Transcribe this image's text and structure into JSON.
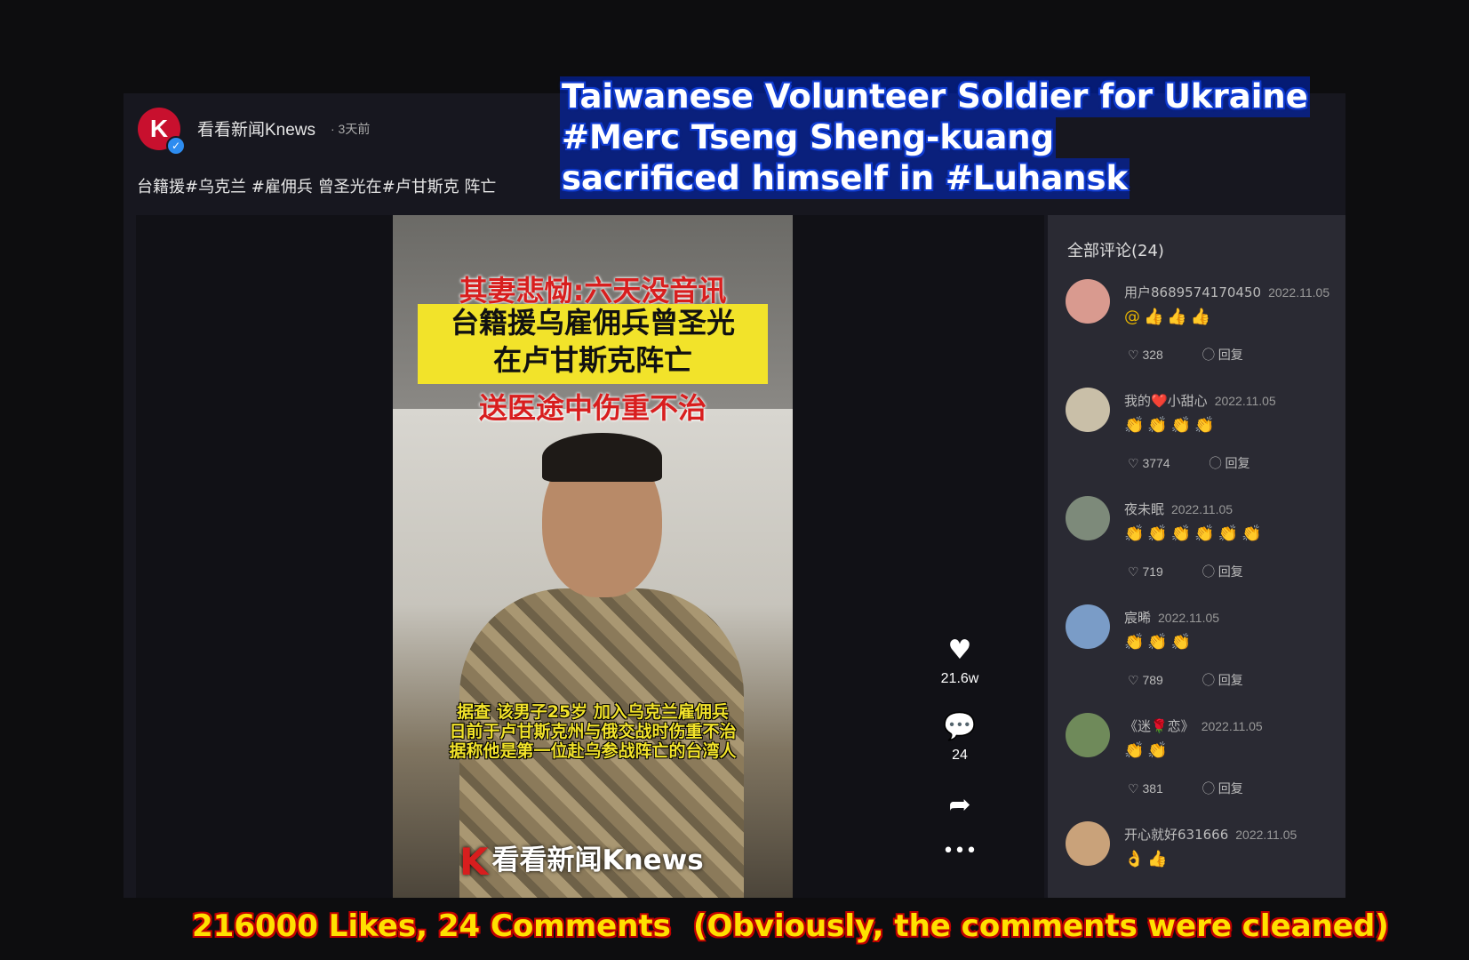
{
  "post": {
    "author": "看看新闻Knews",
    "time": "· 3天前",
    "caption": "台籍援#乌克兰 #雇佣兵 曾圣光在#卢甘斯克 阵亡",
    "logo_letter": "K"
  },
  "overlay": {
    "line1": "Taiwanese Volunteer Soldier for Ukraine",
    "line2": "#Merc  Tseng Sheng-kuang",
    "line3": "sacrificed himself in #Luhansk"
  },
  "video": {
    "banner_top": "其妻悲恸:六天没音讯",
    "headline_1": "台籍援乌雇佣兵曾圣光",
    "headline_2": "在卢甘斯克阵亡",
    "banner_bottom": "送医途中伤重不治",
    "subtitle_1": "据查 该男子25岁 加入乌克兰雇佣兵",
    "subtitle_2": "日前于卢甘斯克州与俄交战时伤重不治",
    "subtitle_3": "据称他是第一位赴乌参战阵亡的台湾人",
    "watermark": "看看新闻Knews"
  },
  "actions": {
    "likes": "21.6w",
    "comments": "24",
    "heart_icon": "heart-icon",
    "comment_icon": "comment-icon",
    "share_icon": "share-icon",
    "more_icon": "more-icon"
  },
  "comments_panel": {
    "title": "全部评论(24)",
    "reply_label": "回复",
    "items": [
      {
        "name": "用户8689574170450",
        "date": "2022.11.05",
        "text": "@👍👍👍",
        "likes": "328",
        "avatar_color": "#d99a8f"
      },
      {
        "name": "我的❤️小甜心",
        "date": "2022.11.05",
        "text": "👏👏👏👏",
        "likes": "3774",
        "avatar_color": "#c9bfa8"
      },
      {
        "name": "夜未眠",
        "date": "2022.11.05",
        "text": "👏👏👏👏👏👏",
        "likes": "719",
        "avatar_color": "#7d8a7a"
      },
      {
        "name": "宸晞",
        "date": "2022.11.05",
        "text": "👏👏👏",
        "likes": "789",
        "avatar_color": "#7a9cc7"
      },
      {
        "name": "《迷🌹恋》",
        "date": "2022.11.05",
        "text": "👏👏",
        "likes": "381",
        "avatar_color": "#6f8a5a"
      },
      {
        "name": "开心就好631666",
        "date": "2022.11.05",
        "text": "👌👍",
        "likes": "",
        "avatar_color": "#c9a27a"
      }
    ]
  },
  "bottom": {
    "left": "216000 Likes, 24 Comments",
    "right": "(Obviously, the comments were cleaned)"
  }
}
